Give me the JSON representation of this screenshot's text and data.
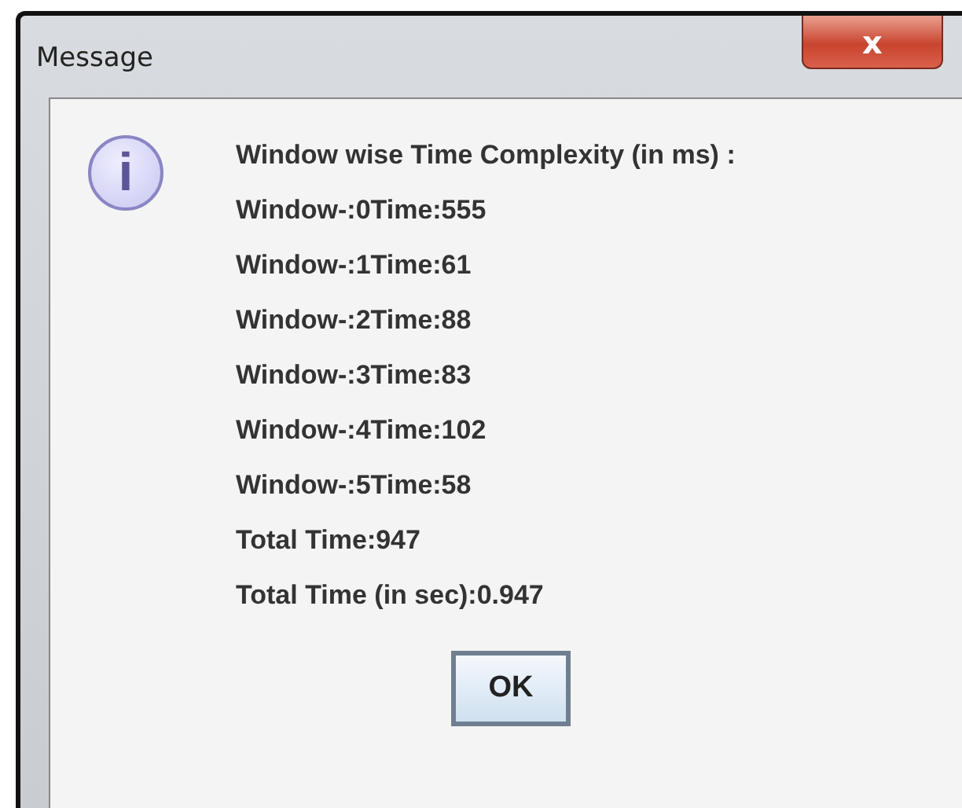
{
  "window": {
    "title": "Message",
    "close_button": "x"
  },
  "message": {
    "icon": "i",
    "lines": [
      "Window wise Time Complexity (in ms) :",
      "Window-:0Time:555",
      "Window-:1Time:61",
      "Window-:2Time:88",
      "Window-:3Time:83",
      "Window-:4Time:102",
      "Window-:5Time:58",
      "Total Time:947",
      "Total Time (in sec):0.947"
    ]
  },
  "buttons": [
    "OK"
  ]
}
